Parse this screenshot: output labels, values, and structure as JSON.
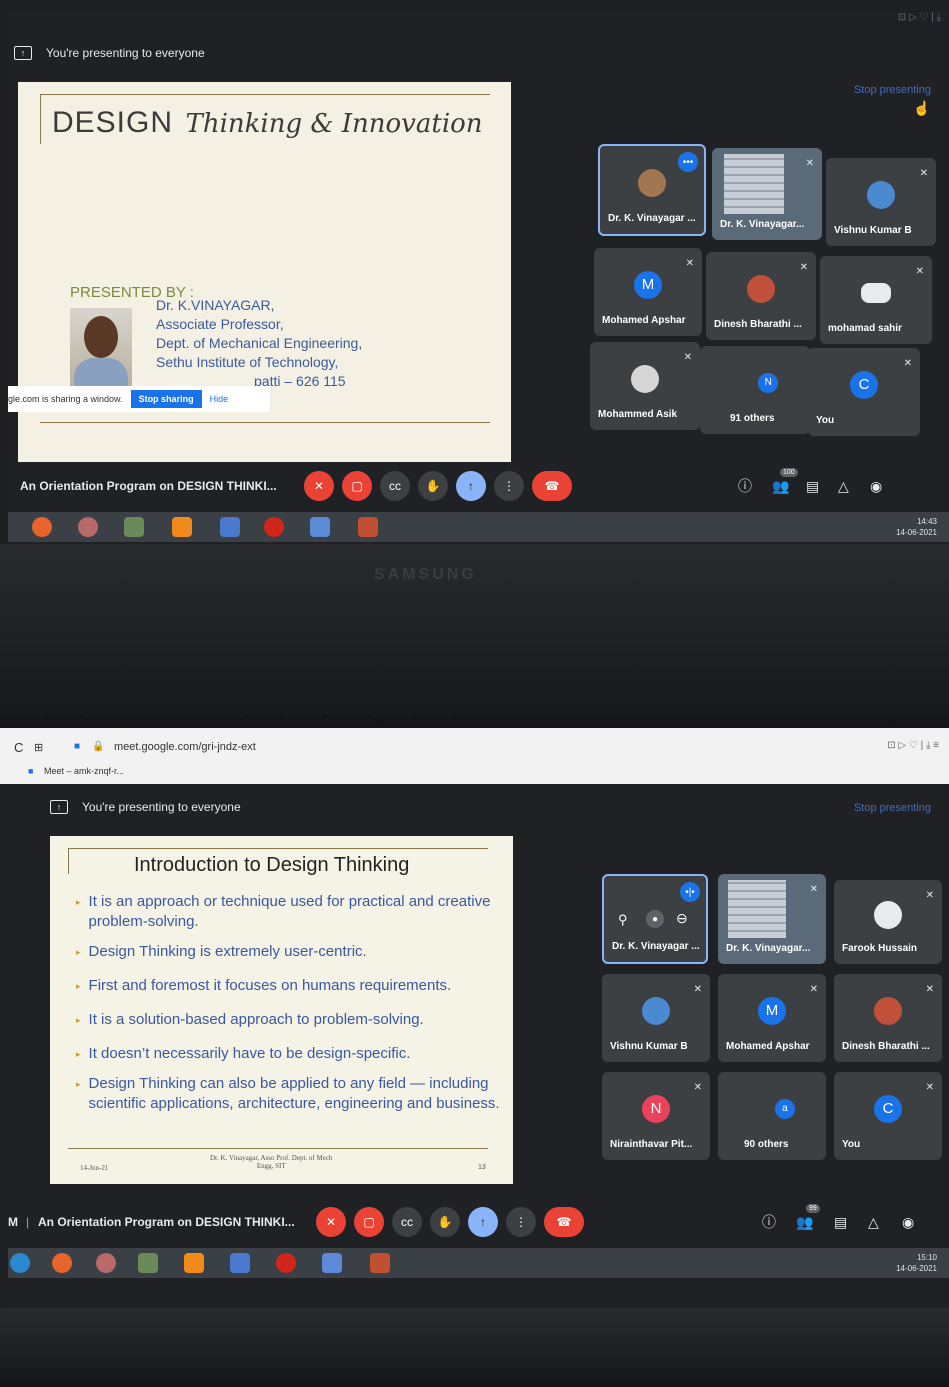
{
  "top_capture": {
    "presenting_text": "You're presenting to everyone",
    "stop_presenting": "Stop presenting",
    "slide": {
      "title_caps": "DESIGN",
      "title_script": "Thinking & Innovation",
      "presented_by": "PRESENTED BY :",
      "lines": [
        "Dr. K.VINAYAGAR,",
        "Associate Professor,",
        "Dept. of Mechanical Engineering,",
        "Sethu Institute of Technology,",
        "patti – 626 115"
      ]
    },
    "share_strip": {
      "text": "gle.com is sharing a window.",
      "stop_label": "Stop sharing",
      "hide_label": "Hide"
    },
    "participants": [
      {
        "name": "Dr. K. Vinayagar ...",
        "kind": "photo"
      },
      {
        "name": "Dr. K. Vinayagar...",
        "kind": "screen"
      },
      {
        "name": "Vishnu Kumar B",
        "kind": "photo"
      },
      {
        "name": "Mohamed Apshar",
        "kind": "letter",
        "letter": "M",
        "color": "#1a73e8"
      },
      {
        "name": "Dinesh Bharathi ...",
        "kind": "photo"
      },
      {
        "name": "mohamad sahir",
        "kind": "photo"
      },
      {
        "name": "Mohammed Asik",
        "kind": "photo"
      },
      {
        "name": "91 others",
        "kind": "others",
        "letter": "N"
      },
      {
        "name": "You",
        "kind": "letter",
        "letter": "C",
        "color": "#1a73e8"
      }
    ],
    "meeting_title": "An Orientation Program on DESIGN THINKI...",
    "people_badge": "100",
    "clock_time": "14:43",
    "clock_date": "14-06-2021",
    "brand": "SAMSUNG"
  },
  "bottom_capture": {
    "url": "meet.google.com/gri-jndz-ext",
    "tab_label": "Meet – amk-znqf-r...",
    "presenting_text": "You're presenting to everyone",
    "stop_presenting": "Stop presenting",
    "slide": {
      "title": "Introduction to Design Thinking",
      "bullets": [
        "It is an approach or technique used for practical and creative problem-solving.",
        "Design Thinking is extremely user-centric.",
        "First and foremost it focuses on humans requirements.",
        "It is a solution-based approach to problem-solving.",
        "It doesn’t necessarily have to be design-specific.",
        "Design Thinking can also be applied to any field — including scientific applications, architecture, engineering and business."
      ],
      "footer_date": "14-Jun-21",
      "footer_author": "Dr. K. Vinayagar, Asso Prof. Dept. of Mech",
      "footer_author_2": "Engg, SIT",
      "footer_page": "13"
    },
    "participants": [
      {
        "name": "Dr. K. Vinayagar ...",
        "kind": "self"
      },
      {
        "name": "Dr. K. Vinayagar...",
        "kind": "screen"
      },
      {
        "name": "Farook Hussain",
        "kind": "photo"
      },
      {
        "name": "Vishnu Kumar B",
        "kind": "photo"
      },
      {
        "name": "Mohamed Apshar",
        "kind": "letter",
        "letter": "M",
        "color": "#1a73e8"
      },
      {
        "name": "Dinesh Bharathi ...",
        "kind": "photo"
      },
      {
        "name": "Nirainthavar Pit...",
        "kind": "letter",
        "letter": "N",
        "color": "#e8435a"
      },
      {
        "name": "90 others",
        "kind": "others",
        "letter": "a"
      },
      {
        "name": "You",
        "kind": "letter",
        "letter": "C",
        "color": "#1a73e8"
      }
    ],
    "meeting_prefix": "M",
    "meeting_title": "An Orientation Program on DESIGN THINKI...",
    "people_badge": "99",
    "clock_time": "15:10",
    "clock_date": "14-06-2021"
  },
  "colors": {
    "accent": "#1a73e8",
    "red": "#ea4335",
    "tile": "#3c4043",
    "bg": "#202124"
  }
}
